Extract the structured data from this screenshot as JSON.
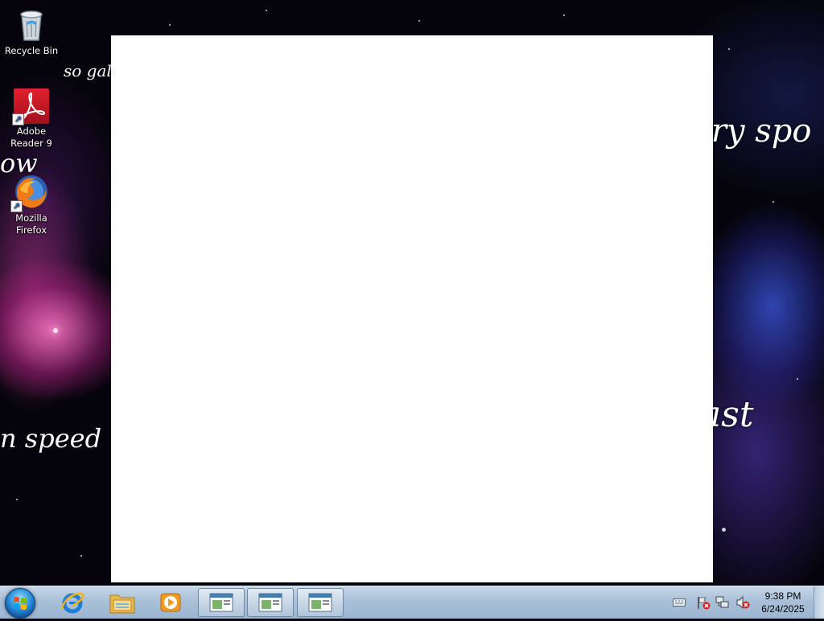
{
  "desktop": {
    "wallpaper_text": [
      "so gala",
      "ow",
      "n speed",
      "ary spo",
      "ast"
    ],
    "icons": [
      {
        "label": "Recycle Bin",
        "icon": "recycle-bin-icon"
      },
      {
        "label": "Adobe Reader 9",
        "icon": "adobe-reader-icon"
      },
      {
        "label": "Mozilla Firefox",
        "icon": "firefox-icon"
      }
    ]
  },
  "taskbar": {
    "start_icon": "windows-start-orb",
    "pinned": [
      {
        "icon": "internet-explorer-icon"
      },
      {
        "icon": "windows-explorer-icon"
      },
      {
        "icon": "media-player-icon"
      }
    ],
    "running": [
      {
        "icon": "window-app-icon"
      },
      {
        "icon": "window-app-icon"
      },
      {
        "icon": "window-app-icon"
      }
    ],
    "tray": {
      "icons": [
        "keyboard-icon",
        "action-center-flag-icon",
        "network-icon",
        "volume-muted-icon"
      ],
      "time": "9:38 PM",
      "date": "6/24/2025"
    }
  },
  "colors": {
    "taskbar": "#a9c0d8",
    "window_bg": "#ffffff",
    "accent_red": "#c8102e"
  }
}
